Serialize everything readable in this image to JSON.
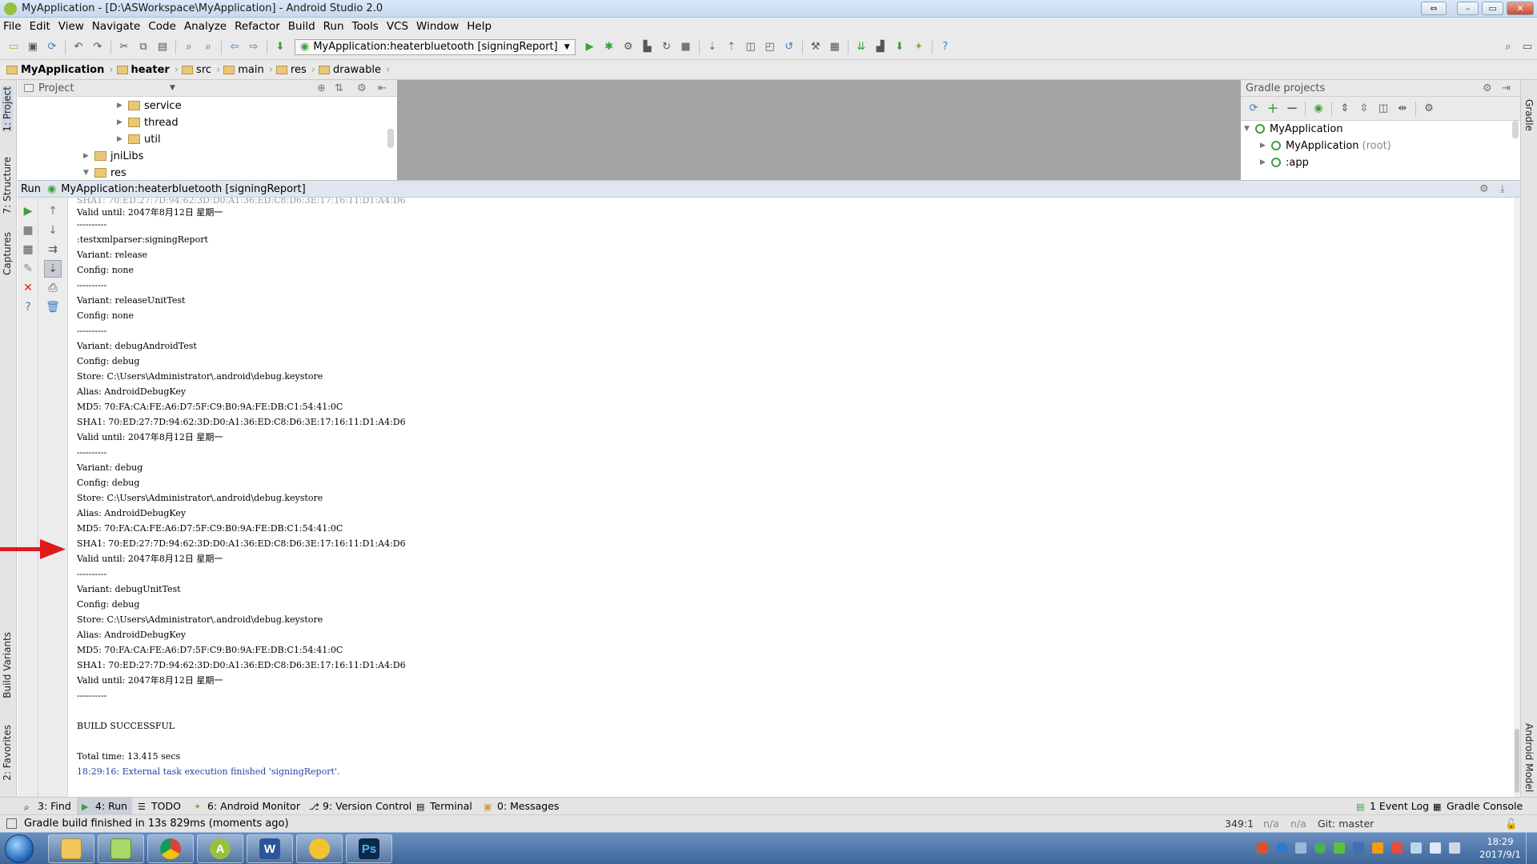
{
  "window": {
    "title": "MyApplication - [D:\\ASWorkspace\\MyApplication] - Android Studio 2.0"
  },
  "menu": [
    "File",
    "Edit",
    "View",
    "Navigate",
    "Code",
    "Analyze",
    "Refactor",
    "Build",
    "Run",
    "Tools",
    "VCS",
    "Window",
    "Help"
  ],
  "toolbar": {
    "run_config": "MyApplication:heaterbluetooth [signingReport]"
  },
  "breadcrumb": [
    "MyApplication",
    "heater",
    "src",
    "main",
    "res",
    "drawable"
  ],
  "project_panel": {
    "header": "Project",
    "tree": [
      "service",
      "thread",
      "util",
      "jniLibs",
      "res"
    ]
  },
  "left_tabs": [
    "1: Project",
    "7: Structure",
    "Captures",
    "Build Variants",
    "2: Favorites"
  ],
  "right_tabs": [
    "Gradle",
    "Android Model"
  ],
  "gradle_panel": {
    "header": "Gradle projects",
    "tree": [
      {
        "label": "MyApplication",
        "suffix": ""
      },
      {
        "label": "MyApplication",
        "suffix": "(root)"
      },
      {
        "label": ":app",
        "suffix": ""
      }
    ]
  },
  "run_panel": {
    "label": "Run",
    "title": "MyApplication:heaterbluetooth [signingReport]",
    "lines": [
      "Valid until: 2047年8月12日 星期一",
      "----------",
      ":testxmlparser:signingReport",
      "Variant: release",
      "Config: none",
      "----------",
      "Variant: releaseUnitTest",
      "Config: none",
      "----------",
      "Variant: debugAndroidTest",
      "Config: debug",
      "Store: C:\\Users\\Administrator\\.android\\debug.keystore",
      "Alias: AndroidDebugKey",
      "MD5: 70:FA:CA:FE:A6:D7:5F:C9:B0:9A:FE:DB:C1:54:41:0C",
      "SHA1: 70:ED:27:7D:94:62:3D:D0:A1:36:ED:C8:D6:3E:17:16:11:D1:A4:D6",
      "Valid until: 2047年8月12日 星期一",
      "----------",
      "Variant: debug",
      "Config: debug",
      "Store: C:\\Users\\Administrator\\.android\\debug.keystore",
      "Alias: AndroidDebugKey",
      "MD5: 70:FA:CA:FE:A6:D7:5F:C9:B0:9A:FE:DB:C1:54:41:0C",
      "SHA1: 70:ED:27:7D:94:62:3D:D0:A1:36:ED:C8:D6:3E:17:16:11:D1:A4:D6",
      "Valid until: 2047年8月12日 星期一",
      "----------",
      "Variant: debugUnitTest",
      "Config: debug",
      "Store: C:\\Users\\Administrator\\.android\\debug.keystore",
      "Alias: AndroidDebugKey",
      "MD5: 70:FA:CA:FE:A6:D7:5F:C9:B0:9A:FE:DB:C1:54:41:0C",
      "SHA1: 70:ED:27:7D:94:62:3D:D0:A1:36:ED:C8:D6:3E:17:16:11:D1:A4:D6",
      "Valid until: 2047年8月12日 星期一",
      "----------",
      "",
      "BUILD SUCCESSFUL",
      "",
      "Total time: 13.415 secs",
      "18:29:16: External task execution finished 'signingReport'."
    ],
    "finish_color": "#2a3fa8"
  },
  "bottom_tabs": [
    {
      "label": "3: Find"
    },
    {
      "label": "4: Run"
    },
    {
      "label": "TODO"
    },
    {
      "label": "6: Android Monitor"
    },
    {
      "label": "9: Version Control"
    },
    {
      "label": "Terminal"
    },
    {
      "label": "0: Messages"
    }
  ],
  "bottom_right_tabs": [
    "1 Event Log",
    "Gradle Console"
  ],
  "status": {
    "message": "Gradle build finished in 13s 829ms (moments ago)",
    "position": "349:1",
    "na1": "n/a",
    "na2": "n/a",
    "git": "Git: master"
  },
  "taskbar": {
    "time": "18:29",
    "date": "2017/9/1",
    "apps": [
      "explorer",
      "notepad",
      "chrome",
      "android-studio",
      "word",
      "wechat",
      "photoshop"
    ]
  },
  "colors": {
    "accent_red_arrow": "#e0191b",
    "run_green": "#3c9f3c"
  }
}
